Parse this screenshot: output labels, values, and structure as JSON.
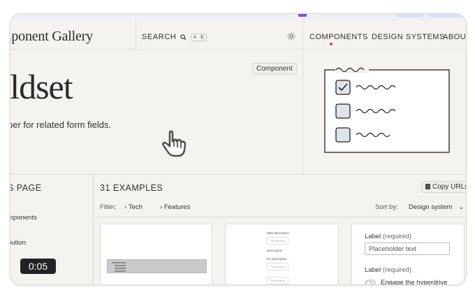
{
  "header": {
    "brand": "mponent Gallery",
    "search_label": "SEARCH",
    "search_shortcut": "⌘ K",
    "theme_icon": "sun-icon",
    "nav": [
      {
        "label": "COMPONENTS",
        "active": true
      },
      {
        "label": "DESIGN SYSTEMS",
        "active": false
      },
      {
        "label": "ABOUT",
        "active": false
      }
    ],
    "active_color": "#e0463a"
  },
  "hero": {
    "badge": "Component",
    "title": "eldset",
    "description": "per for related form fields."
  },
  "sidebar": {
    "title": "S PAGE",
    "items": [
      "mponents",
      "bution"
    ]
  },
  "video": {
    "timer": "0:05"
  },
  "main": {
    "count": "31 EXAMPLES",
    "copy_label": "Copy URLs",
    "filter_label": "Filter:",
    "filters": [
      "Tech",
      "Features"
    ],
    "sort_label": "Sort by:",
    "sort_value": "Design system"
  },
  "cards": {
    "card2": {
      "with_desc": "With description",
      "placeholder1": "Placeholder",
      "desc": "Description",
      "no_desc": "No description",
      "placeholder2": "Placeholder",
      "placeholder3": "Placeholder"
    },
    "card3": {
      "label1": "Label",
      "required1": "(required)",
      "placeholder": "Placeholder text",
      "label2": "Label",
      "required2": "(required)",
      "toggle_label": "Engage the hyperdrive"
    }
  }
}
